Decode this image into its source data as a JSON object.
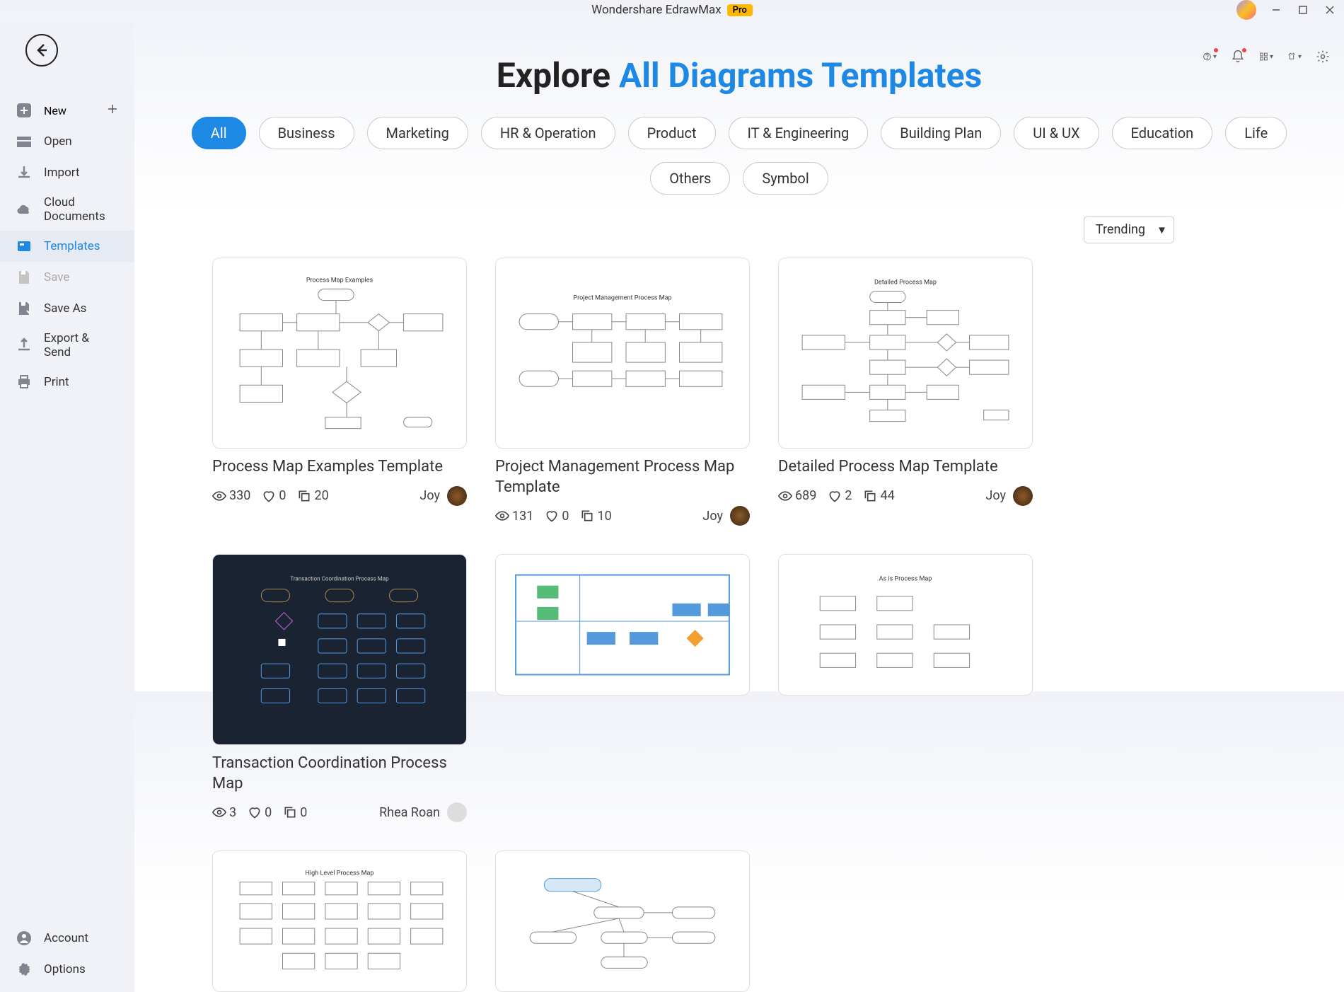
{
  "title": "Wondershare EdrawMax",
  "pro": "Pro",
  "sidebar": {
    "new": "New",
    "open": "Open",
    "import": "Import",
    "cloud": "Cloud Documents",
    "templates": "Templates",
    "save": "Save",
    "saveAs": "Save As",
    "export": "Export & Send",
    "print": "Print",
    "account": "Account",
    "options": "Options"
  },
  "heading": {
    "prefix": "Explore ",
    "blue": "All Diagrams Templates"
  },
  "filters": [
    "All",
    "Business",
    "Marketing",
    "HR & Operation",
    "Product",
    "IT & Engineering",
    "Building Plan",
    "UI & UX",
    "Education",
    "Life",
    "Others",
    "Symbol"
  ],
  "activeFilter": "All",
  "sort": "Trending",
  "cards": [
    {
      "title": "Process Map Examples Template",
      "views": "330",
      "likes": "0",
      "copies": "20",
      "author": "Joy",
      "preview_label": "Process Map Examples"
    },
    {
      "title": "Project Management Process Map Template",
      "views": "131",
      "likes": "0",
      "copies": "10",
      "author": "Joy",
      "preview_label": "Project Management Process Map"
    },
    {
      "title": "Detailed Process Map Template",
      "views": "689",
      "likes": "2",
      "copies": "44",
      "author": "Joy",
      "preview_label": "Detailed Process Map"
    },
    {
      "title": "Transaction Coordination Process Map",
      "views": "3",
      "likes": "0",
      "copies": "0",
      "author": "Rhea Roan",
      "preview_label": "Transaction Coordination Process Map"
    },
    {
      "title": "",
      "views": "",
      "likes": "",
      "copies": "",
      "author": "",
      "preview_label": ""
    },
    {
      "title": "",
      "views": "",
      "likes": "",
      "copies": "",
      "author": "",
      "preview_label": "As Is Process Map"
    },
    {
      "title": "",
      "views": "",
      "likes": "",
      "copies": "",
      "author": "",
      "preview_label": "High Level Process Map"
    },
    {
      "title": "",
      "views": "",
      "likes": "",
      "copies": "",
      "author": "",
      "preview_label": ""
    }
  ]
}
